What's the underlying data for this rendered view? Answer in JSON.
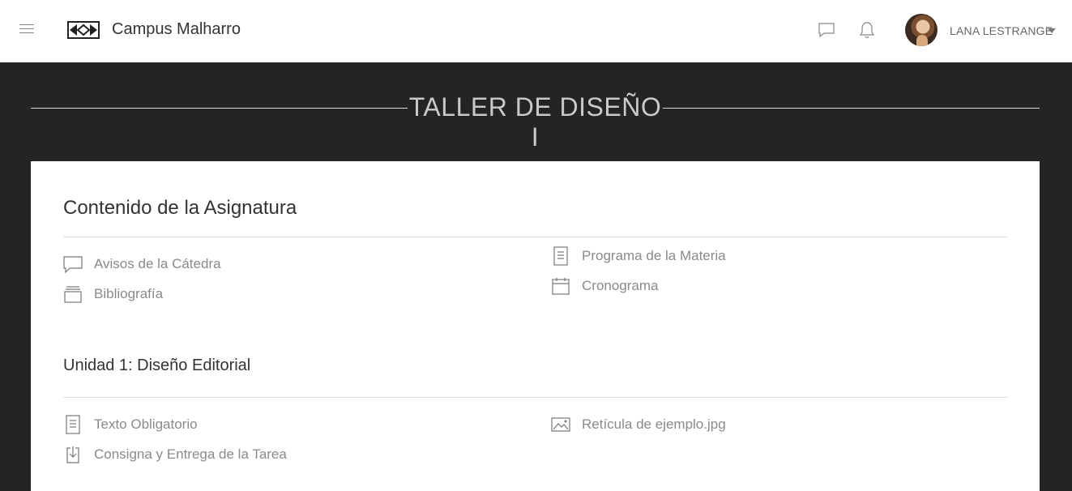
{
  "header": {
    "brand": "Campus Malharro",
    "user_name": "LANA LESTRANGE"
  },
  "page": {
    "title": "TALLER DE DISEÑO I"
  },
  "content": {
    "section_title": "Contenido de la Asignatura",
    "general_items": [
      {
        "label": "Avisos de la Cátedra",
        "icon": "chat-icon"
      },
      {
        "label": "Bibliografía",
        "icon": "stack-icon"
      },
      {
        "label": "Programa de la Materia",
        "icon": "document-icon"
      },
      {
        "label": "Cronograma",
        "icon": "calendar-icon"
      }
    ],
    "unit_title": "Unidad 1: Diseño Editorial",
    "unit_items": [
      {
        "label": "Texto Obligatorio",
        "icon": "document-icon"
      },
      {
        "label": "Consigna y Entrega de la Tarea",
        "icon": "download-icon"
      },
      {
        "label": "Retícula de ejemplo.jpg",
        "icon": "image-icon"
      }
    ]
  }
}
